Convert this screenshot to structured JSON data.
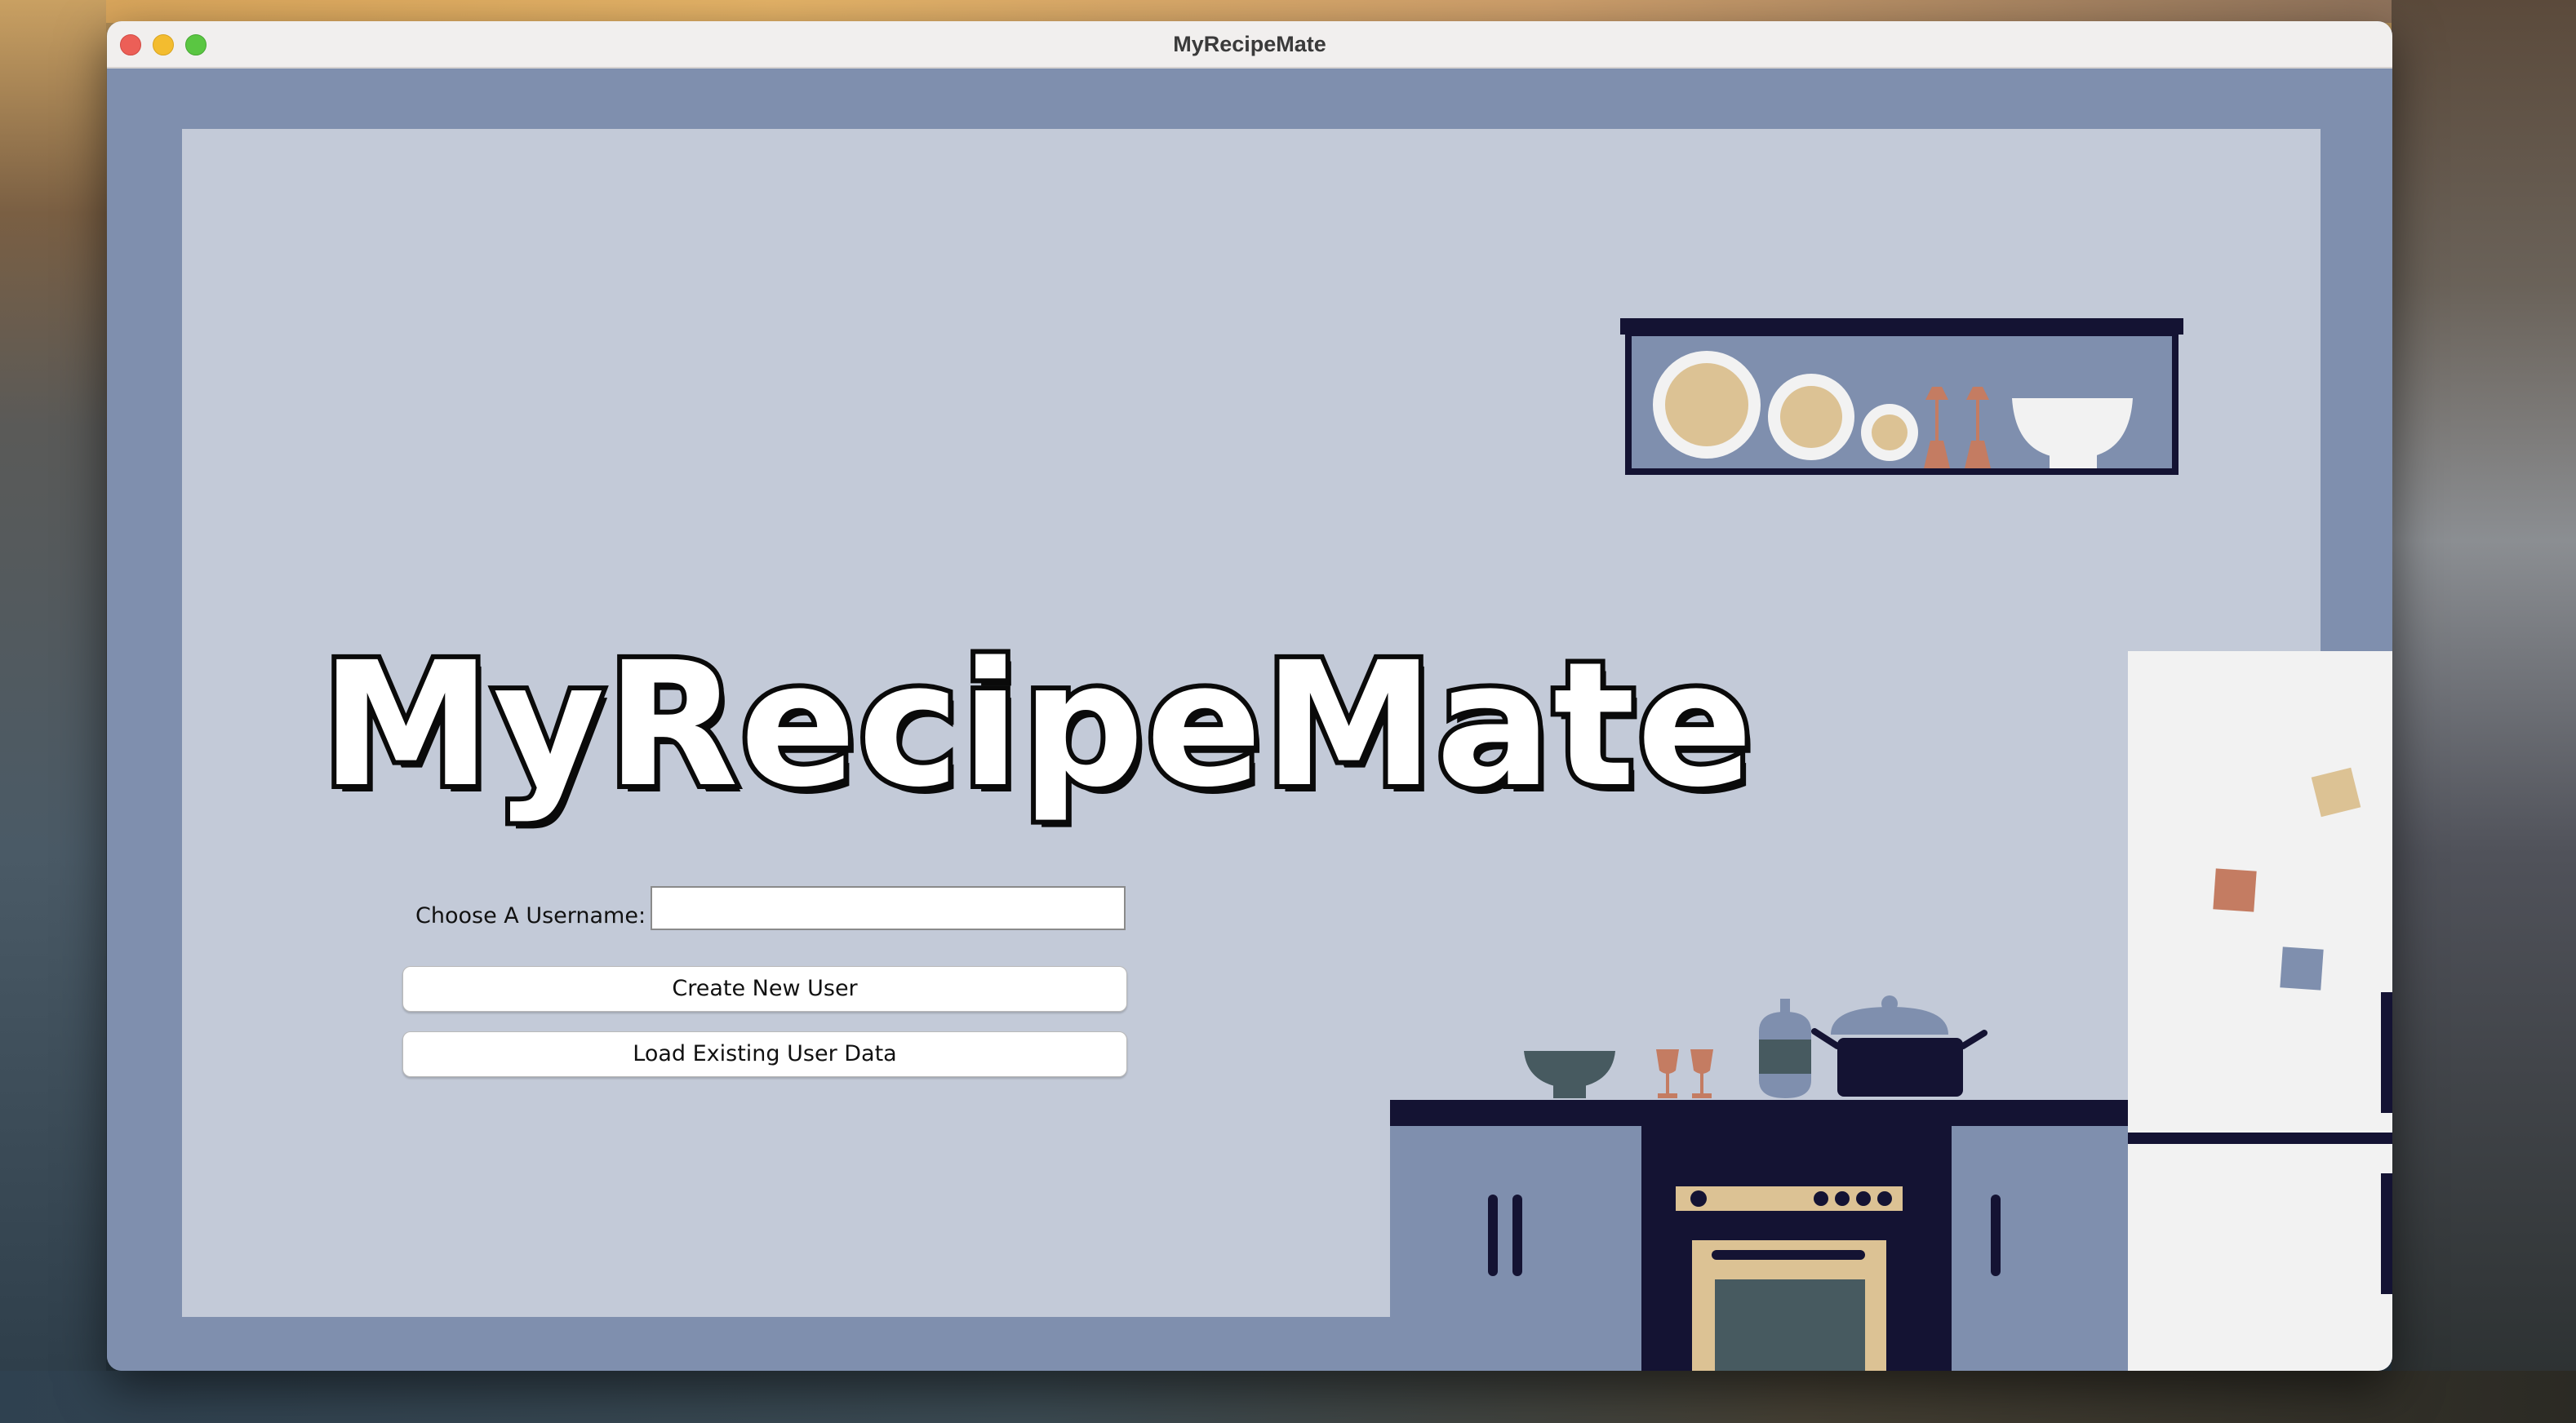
{
  "window": {
    "title": "MyRecipeMate"
  },
  "main": {
    "app_title": "MyRecipeMate",
    "username_label": "Choose A Username:",
    "username_value": "",
    "create_button": "Create New User",
    "load_button": "Load Existing User Data"
  },
  "theme": {
    "wall": "#c3cad8",
    "frame": "#7f8fae",
    "navy": "#141333",
    "beige": "#dcc294",
    "terracotta": "#c47c62",
    "slate": "#475a60",
    "white": "#f2f2f2"
  },
  "illustration": {
    "shelf_items": [
      "plate-icon",
      "plate-icon",
      "plate-icon",
      "wine-glass-icon",
      "wine-glass-icon",
      "bowl-icon"
    ],
    "counter_items": [
      "bowl-icon",
      "wine-glass-icon",
      "wine-glass-icon",
      "bottle-icon",
      "pot-icon"
    ],
    "fridge_magnets": [
      "magnet-icon",
      "magnet-icon",
      "magnet-icon"
    ]
  }
}
